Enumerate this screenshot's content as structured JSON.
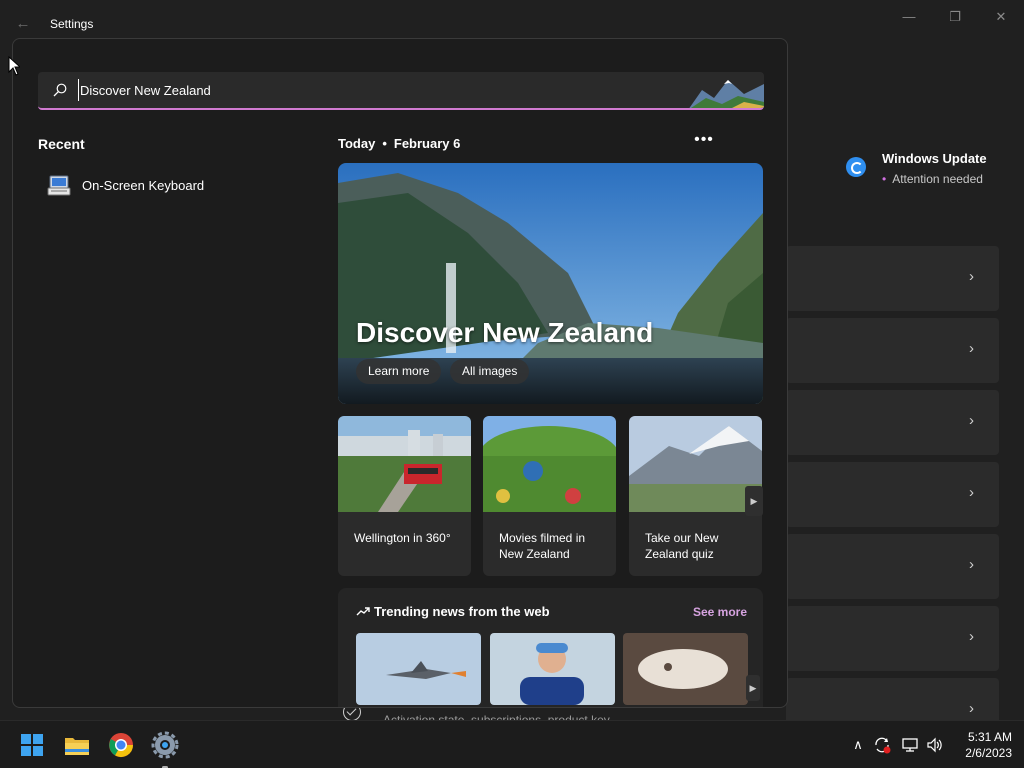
{
  "window": {
    "title": "Settings",
    "back_icon": "back-arrow-icon",
    "minimize_icon": "minimize-icon",
    "maximize_icon": "restore-icon",
    "close_icon": "close-icon"
  },
  "windows_update": {
    "title": "Windows Update",
    "status": "Attention needed",
    "icon": "sync-icon",
    "accent": "#2f8ff0",
    "status_dot_color": "#d070e0"
  },
  "background_rows": {
    "count": 7,
    "chevron_icon": "chevron-right-icon"
  },
  "background_activation": {
    "icon": "check-circle-icon",
    "partial_text": "Activation state, subscriptions, product key"
  },
  "search": {
    "query": "Discover New Zealand",
    "icon": "search-icon",
    "accent_color": "#d07ad0"
  },
  "recent": {
    "heading": "Recent",
    "items": [
      {
        "label": "On-Screen Keyboard",
        "icon": "on-screen-keyboard-icon"
      }
    ]
  },
  "today": {
    "label": "Today",
    "separator": "•",
    "date": "February 6",
    "more_icon": "more-options-icon"
  },
  "hero": {
    "title": "Discover New Zealand",
    "buttons": [
      "Learn more",
      "All images"
    ]
  },
  "cards": [
    {
      "label": "Wellington in 360°"
    },
    {
      "label": "Movies filmed in New Zealand"
    },
    {
      "label": "Take our New Zealand quiz"
    }
  ],
  "trending": {
    "heading": "Trending news from the web",
    "see_more": "See more",
    "icon": "trending-up-icon",
    "link_color": "#d6a3e0"
  },
  "taskbar": {
    "apps": [
      "start-icon",
      "file-explorer-icon",
      "chrome-icon",
      "settings-icon"
    ],
    "tray_icons": [
      "chevron-up-icon",
      "sync-warning-icon",
      "network-icon",
      "volume-icon"
    ],
    "time": "5:31 AM",
    "date": "2/6/2023"
  }
}
